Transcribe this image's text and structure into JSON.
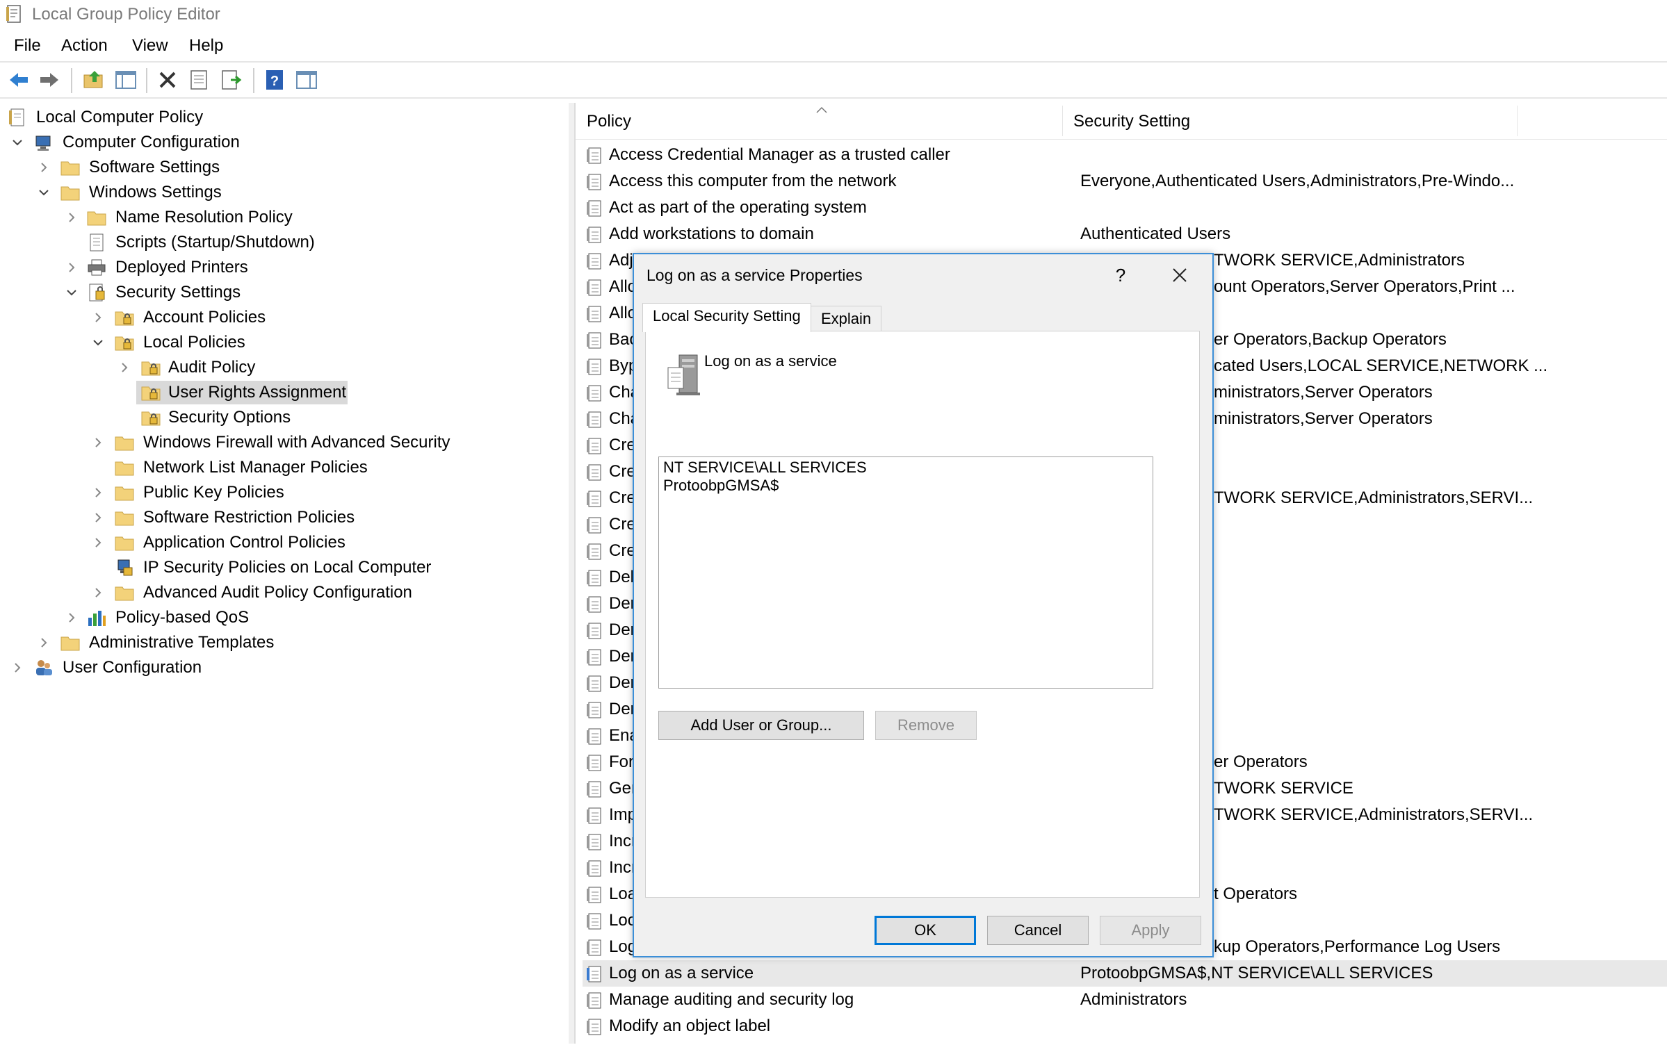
{
  "window": {
    "title": "Local Group Policy Editor"
  },
  "menu": [
    "File",
    "Action",
    "View",
    "Help"
  ],
  "toolbar": {
    "icons": [
      "back-icon",
      "forward-icon",
      "up-folder-icon",
      "show-hide-tree-icon",
      "delete-icon",
      "properties-icon",
      "export-list-icon",
      "help-icon",
      "show-action-pane-icon"
    ]
  },
  "tree": {
    "root": "Local Computer Policy",
    "computer_configuration": "Computer Configuration",
    "software_settings": "Software Settings",
    "windows_settings": "Windows Settings",
    "name_resolution_policy": "Name Resolution Policy",
    "scripts": "Scripts (Startup/Shutdown)",
    "deployed_printers": "Deployed Printers",
    "security_settings": "Security Settings",
    "account_policies": "Account Policies",
    "local_policies": "Local Policies",
    "audit_policy": "Audit Policy",
    "user_rights_assignment": "User Rights Assignment",
    "security_options": "Security Options",
    "windows_firewall": "Windows Firewall with Advanced Security",
    "network_list_manager": "Network List Manager Policies",
    "public_key_policies": "Public Key Policies",
    "software_restriction": "Software Restriction Policies",
    "application_control": "Application Control Policies",
    "ip_security": "IP Security Policies on Local Computer",
    "advanced_audit": "Advanced Audit Policy Configuration",
    "policy_based_qos": "Policy-based QoS",
    "administrative_templates": "Administrative Templates",
    "user_configuration": "User Configuration"
  },
  "list": {
    "columns": {
      "policy": "Policy",
      "security_setting": "Security Setting"
    },
    "rows": [
      {
        "name": "Access Credential Manager as a trusted caller",
        "setting": ""
      },
      {
        "name": "Access this computer from the network",
        "setting": "Everyone,Authenticated Users,Administrators,Pre-Windo..."
      },
      {
        "name": "Act as part of the operating system",
        "setting": ""
      },
      {
        "name": "Add workstations to domain",
        "setting": "Authenticated Users"
      },
      {
        "name": "Adj",
        "setting": ""
      },
      {
        "name": "Allo",
        "setting": ""
      },
      {
        "name": "Allo",
        "setting": ""
      },
      {
        "name": "Bac",
        "setting": ""
      },
      {
        "name": "Byp",
        "setting": ""
      },
      {
        "name": "Cha",
        "setting": ""
      },
      {
        "name": "Cha",
        "setting": ""
      },
      {
        "name": "Cre",
        "setting": ""
      },
      {
        "name": "Cre",
        "setting": ""
      },
      {
        "name": "Cre",
        "setting": ""
      },
      {
        "name": "Cre",
        "setting": ""
      },
      {
        "name": "Cre",
        "setting": ""
      },
      {
        "name": "Deb",
        "setting": ""
      },
      {
        "name": "Der",
        "setting": ""
      },
      {
        "name": "Der",
        "setting": ""
      },
      {
        "name": "Der",
        "setting": ""
      },
      {
        "name": "Der",
        "setting": ""
      },
      {
        "name": "Der",
        "setting": ""
      },
      {
        "name": "Ena",
        "setting": ""
      },
      {
        "name": "For",
        "setting": ""
      },
      {
        "name": "Ger",
        "setting": ""
      },
      {
        "name": "Imp",
        "setting": ""
      },
      {
        "name": "Incr",
        "setting": ""
      },
      {
        "name": "Incr",
        "setting": ""
      },
      {
        "name": "Loa",
        "setting": ""
      },
      {
        "name": "Loc",
        "setting": ""
      },
      {
        "name": "Log",
        "setting": ""
      },
      {
        "name": "Log on as a service",
        "setting": "ProtoobpGMSA$,NT SERVICE\\ALL SERVICES"
      },
      {
        "name": "Manage auditing and security log",
        "setting": "Administrators"
      },
      {
        "name": "Modify an object label",
        "setting": ""
      }
    ],
    "partial_settings": [
      "TWORK SERVICE,Administrators",
      "ount Operators,Server Operators,Print ...",
      "er Operators,Backup Operators",
      "cated Users,LOCAL SERVICE,NETWORK ...",
      "ministrators,Server Operators",
      "ministrators,Server Operators",
      "TWORK SERVICE,Administrators,SERVI...",
      "er Operators",
      "TWORK SERVICE",
      "TWORK SERVICE,Administrators,SERVI...",
      "t Operators",
      "kup Operators,Performance Log Users"
    ]
  },
  "dialog": {
    "title": "Log on as a service Properties",
    "help": "?",
    "close": "✕",
    "tabs": [
      "Local Security Setting",
      "Explain"
    ],
    "policy_name": "Log on as a service",
    "accounts": [
      "NT SERVICE\\ALL SERVICES",
      "ProtoobpGMSA$"
    ],
    "add_button": "Add User or Group...",
    "remove_button": "Remove",
    "ok_button": "OK",
    "cancel_button": "Cancel",
    "apply_button": "Apply"
  }
}
